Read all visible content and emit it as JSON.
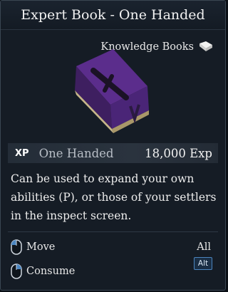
{
  "item": {
    "title": "Expert Book - One Handed",
    "category": "Knowledge Books",
    "category_icon": "book-icon",
    "illustration": "purple-book-sword-icon"
  },
  "xp": {
    "badge": "XP",
    "skill": "One Handed",
    "amount": "18,000 Exp"
  },
  "description": "Can be used to expand your own abilities (P), or those of your settlers in the inspect screen.",
  "actions": [
    {
      "label": "Move",
      "icon": "left-mouse-icon"
    },
    {
      "label": "Consume",
      "icon": "right-mouse-icon"
    }
  ],
  "modifiers": {
    "all_label": "All",
    "alt_key": "Alt"
  },
  "colors": {
    "background": "#151c25",
    "border": "#3a4652",
    "book": "#5b2d8c",
    "mouse_highlight": "#4c86c0"
  }
}
